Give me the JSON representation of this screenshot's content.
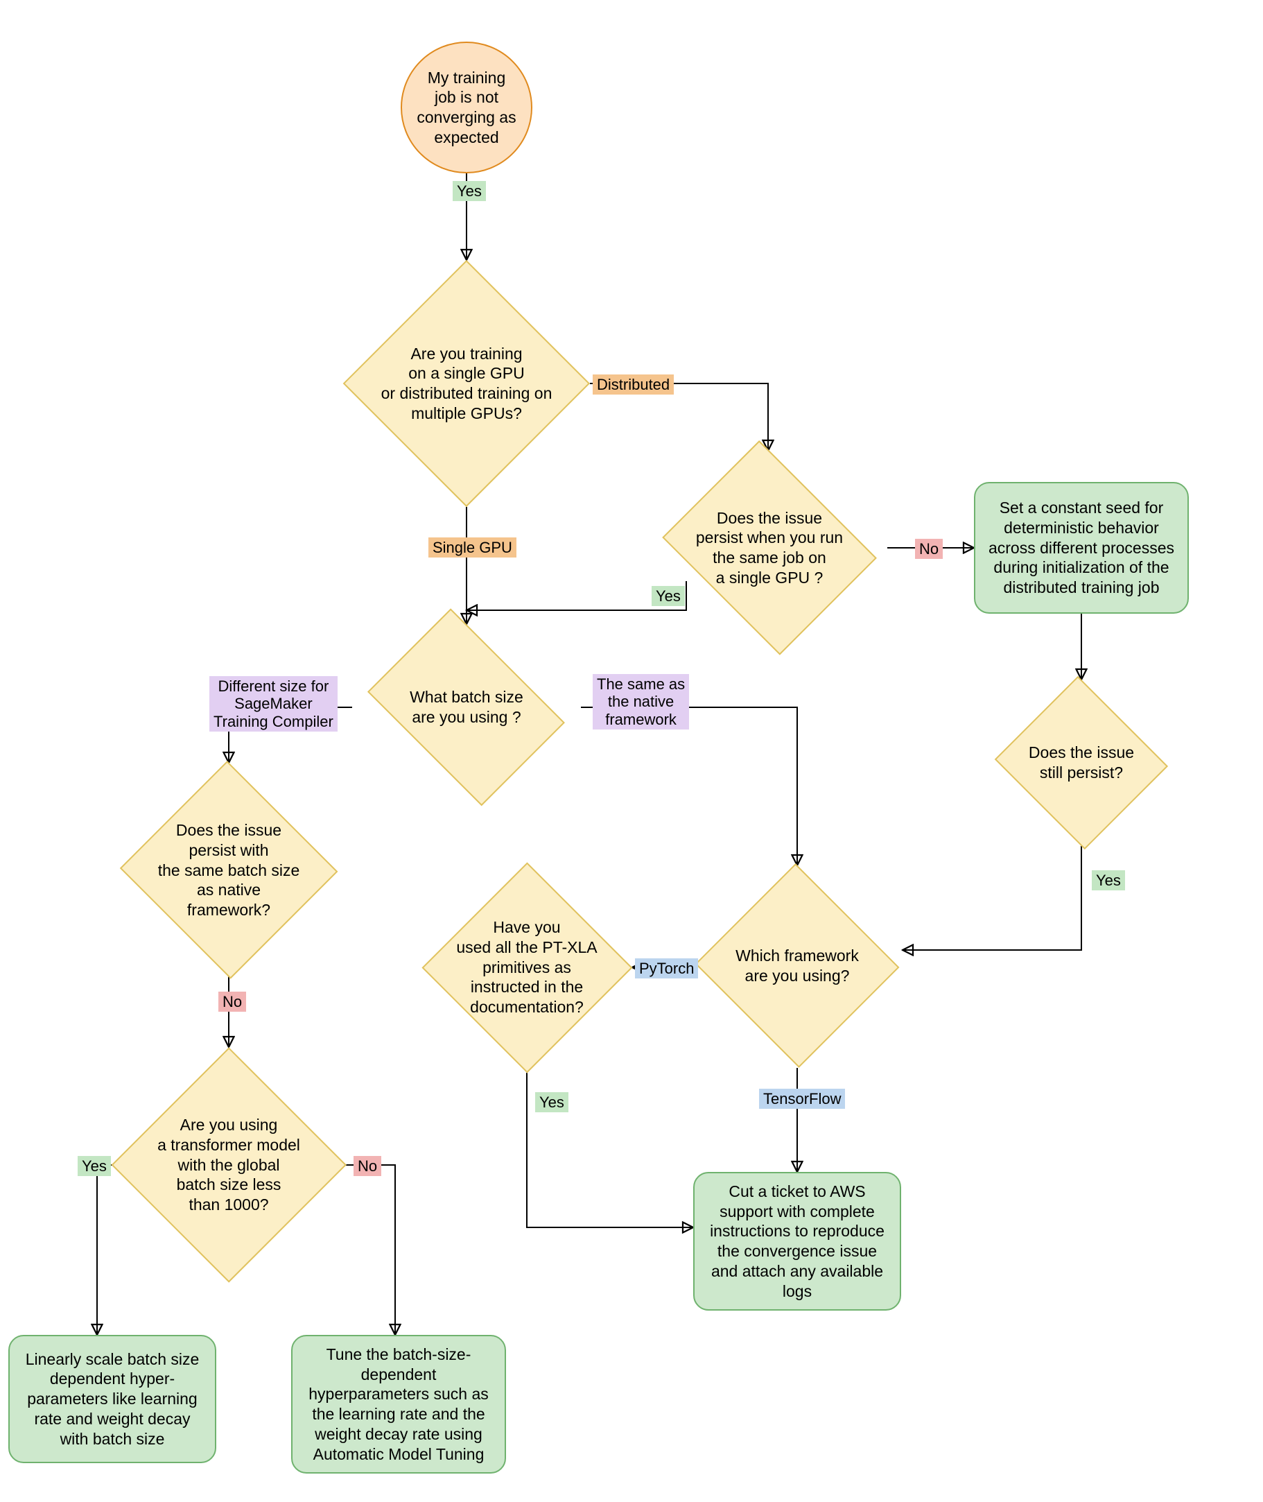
{
  "nodes": {
    "start": "My training\njob is not\nconverging as\nexpected",
    "q_gpu": "Are you training\non a single GPU\nor distributed training on\nmultiple GPUs?",
    "q_persist_single": "Does the issue\npersist when you run\nthe same job on\na single GPU ?",
    "t_seed": "Set a constant seed for\ndeterministic behavior\nacross different processes\nduring initialization of the\ndistributed training job",
    "q_still": "Does the issue\nstill persist?",
    "q_batch": "What batch size\nare you using ?",
    "q_native_same": "Does the issue\npersist with\nthe same batch size\nas native\nframework?",
    "q_framework": "Which framework\nare you using?",
    "q_ptxla": "Have you\nused all the PT-XLA\nprimitives as\ninstructed in the\ndocumentation?",
    "q_transformer": "Are you using\na transformer model\nwith the global\nbatch size less\nthan 1000?",
    "t_ticket": "Cut a ticket to AWS\nsupport with complete\ninstructions to reproduce\nthe convergence issue\nand attach any available\nlogs",
    "t_linear": "Linearly scale batch size\ndependent hyper-\nparameters like learning\nrate and weight decay\nwith batch size",
    "t_tune": "Tune the batch-size-\ndependent\nhyperparameters such as\nthe learning rate and the\nweight decay rate using\nAutomatic Model Tuning"
  },
  "edge_labels": {
    "yes_start": "Yes",
    "distributed": "Distributed",
    "single_gpu": "Single GPU",
    "persist_yes": "Yes",
    "persist_no": "No",
    "still_yes": "Yes",
    "batch_diff": "Different size for\nSageMaker\nTraining Compiler",
    "batch_same": "The same as\nthe native\nframework",
    "native_no": "No",
    "trans_yes": "Yes",
    "trans_no": "No",
    "fw_pytorch": "PyTorch",
    "fw_tf": "TensorFlow",
    "ptxla_yes": "Yes"
  },
  "colors": {
    "start_fill": "#fde1c1",
    "start_stroke": "#e08a1e",
    "decision_fill": "#fcefc7",
    "decision_stroke": "#e0c25e",
    "terminal_fill": "#cde8cc",
    "terminal_stroke": "#6fb26e",
    "label_green": "#c3e6c3",
    "label_red": "#f2b3b3",
    "label_orange": "#f5c48d",
    "label_purple": "#e2cff2",
    "label_blue": "#bcd5ef"
  }
}
